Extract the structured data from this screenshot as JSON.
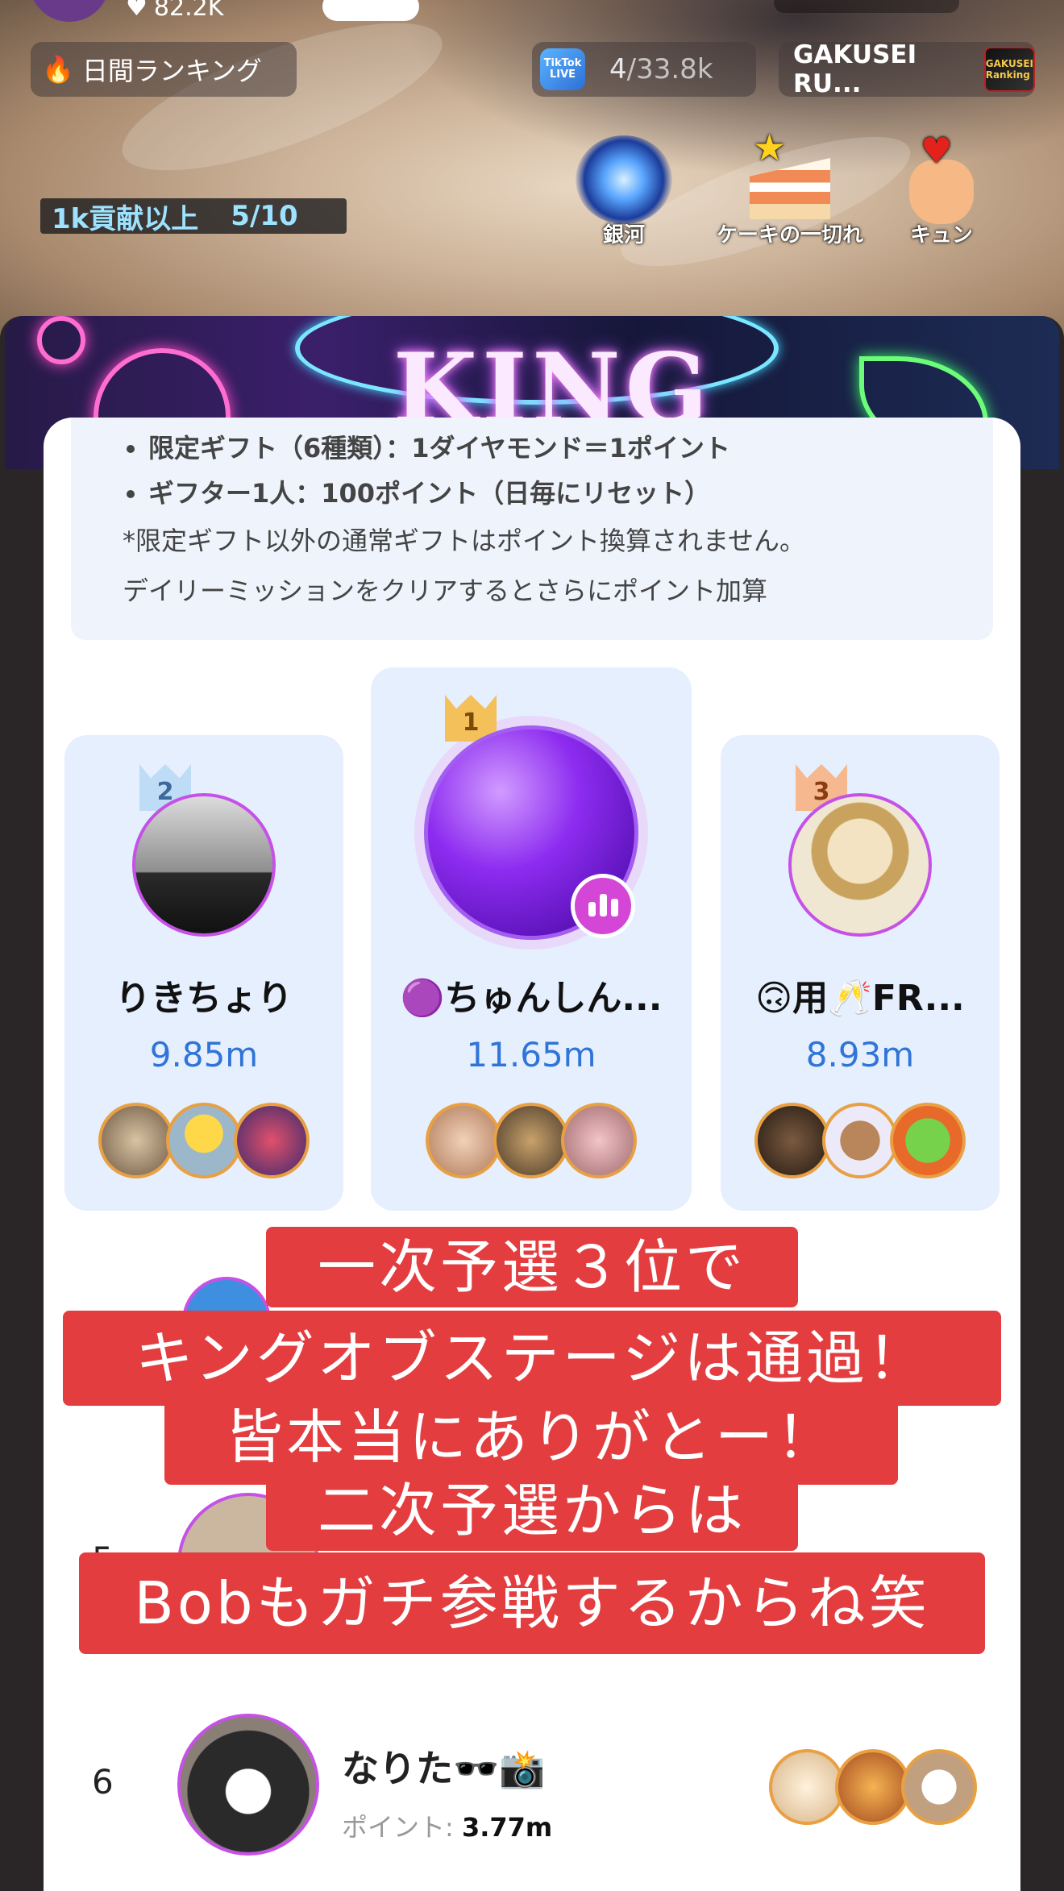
{
  "stream": {
    "likes": "82.2K",
    "daily_ranking_label": "日間ランキング",
    "viewer_logo_text": "TikTok LIVE",
    "viewer_rank": "4",
    "viewer_total": "33.8k",
    "school_label": "GAKUSEI RU...",
    "school_badge_text": "GAKUSEI Ranking",
    "contribution_label": "1k貢献以上",
    "contribution_progress": "5/10",
    "gifts": [
      {
        "label": "銀河",
        "icon": "galaxy-gift"
      },
      {
        "label": "ケーキの一切れ",
        "icon": "cake-slice-gift"
      },
      {
        "label": "キュン",
        "icon": "finger-heart-gift"
      }
    ]
  },
  "banner": {
    "title": "KING"
  },
  "rules": {
    "items": [
      "限定ギフト（6種類）：1ダイヤモンド＝1ポイント",
      "ギフター1人：100ポイント（日毎にリセット）"
    ],
    "notes": [
      "*限定ギフト以外の通常ギフトはポイント換算されません。",
      "デイリーミッションをクリアするとさらにポイント加算"
    ]
  },
  "podium": [
    {
      "rank": "2",
      "name": "りきちょり",
      "points": "9.85m"
    },
    {
      "rank": "1",
      "name": "🟣ちゅんしん...",
      "points": "11.65m"
    },
    {
      "rank": "3",
      "name": "🙃用🥂FR...",
      "points": "8.93m"
    }
  ],
  "rows": [
    {
      "rank": "5"
    },
    {
      "rank": "6",
      "name": "なりた🕶️📸",
      "points_label": "ポイント:",
      "points": "3.77m"
    }
  ],
  "caption": {
    "lines": [
      "一次予選３位で",
      "キングオブステージは通過！",
      "皆本当にありがとー！",
      "二次予選からは",
      "Bobもガチ参戦するからね笑"
    ]
  },
  "colors": {
    "caption_bg": "#e43d3f",
    "points_blue": "#2f74d8",
    "avatar_ring": "#c551e6",
    "card_bg": "#e6effe"
  }
}
